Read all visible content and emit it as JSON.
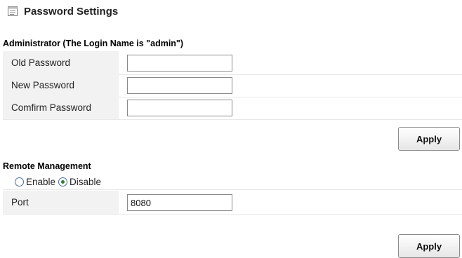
{
  "page": {
    "title": "Password Settings"
  },
  "administrator": {
    "section_title": "Administrator (The Login Name is \"admin\")",
    "fields": [
      {
        "label": "Old Password",
        "value": ""
      },
      {
        "label": "New Password",
        "value": ""
      },
      {
        "label": "Comfirm Password",
        "value": ""
      }
    ],
    "apply_label": "Apply"
  },
  "remote_management": {
    "section_title": "Remote Management",
    "options": [
      {
        "label": "Enable",
        "checked": false
      },
      {
        "label": "Disable",
        "checked": true
      }
    ],
    "port_label": "Port",
    "port_value": "8080",
    "apply_label": "Apply"
  },
  "icons": {
    "title_icon": "settings-page-icon",
    "radio_checked_color": "#2e7d32"
  }
}
